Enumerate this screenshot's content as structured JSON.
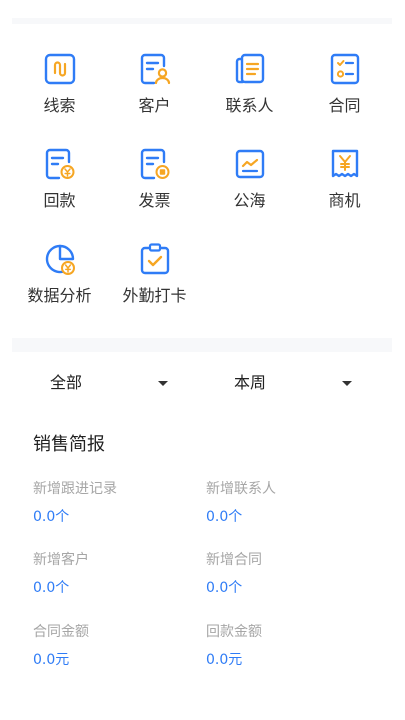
{
  "modules": [
    {
      "label": "线索",
      "icon": "clue-icon"
    },
    {
      "label": "客户",
      "icon": "customer-icon"
    },
    {
      "label": "联系人",
      "icon": "contact-icon"
    },
    {
      "label": "合同",
      "icon": "contract-icon"
    },
    {
      "label": "回款",
      "icon": "payment-icon"
    },
    {
      "label": "发票",
      "icon": "invoice-icon"
    },
    {
      "label": "公海",
      "icon": "public-pool-icon"
    },
    {
      "label": "商机",
      "icon": "opportunity-icon"
    },
    {
      "label": "数据分析",
      "icon": "data-analysis-icon"
    },
    {
      "label": "外勤打卡",
      "icon": "field-checkin-icon"
    }
  ],
  "filters": {
    "scope": "全部",
    "period": "本周"
  },
  "report": {
    "title": "销售简报",
    "stats": [
      {
        "name": "新增跟进记录",
        "value": "0.0个"
      },
      {
        "name": "新增联系人",
        "value": "0.0个"
      },
      {
        "name": "新增客户",
        "value": "0.0个"
      },
      {
        "name": "新增合同",
        "value": "0.0个"
      },
      {
        "name": "合同金额",
        "value": "0.0元"
      },
      {
        "name": "回款金额",
        "value": "0.0元"
      }
    ]
  },
  "colors": {
    "icon_blue": "#2f7cf6",
    "icon_orange": "#f6a623",
    "stat_value": "#2f7cf6",
    "stat_label": "#a6a6a6"
  }
}
